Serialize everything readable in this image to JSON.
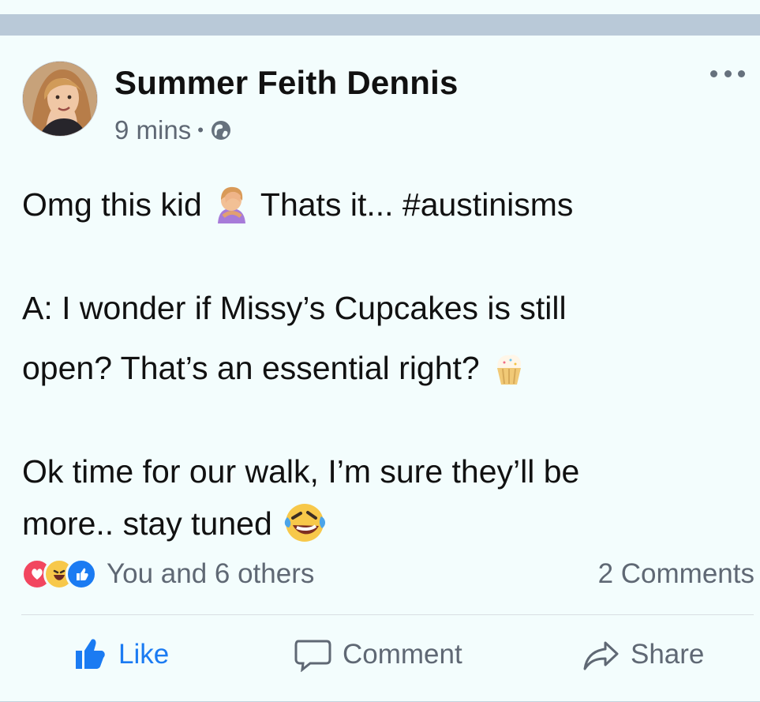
{
  "post": {
    "author": "Summer Feith Dennis",
    "time": "9 mins",
    "separator": "•",
    "privacy_icon": "globe-icon",
    "lines": [
      {
        "text_a": "Omg this kid",
        "text_b": " Thats it... #austinisms"
      },
      {
        "text": "A: I wonder if Missy’s Cupcakes is still"
      },
      {
        "text": "open? That’s an essential right? "
      },
      {
        "text": "Ok time for our walk, I’m sure they’ll be"
      },
      {
        "text": "more.. stay tuned"
      }
    ],
    "emojis": [
      "face-palm-emoji",
      "cupcake-emoji",
      "rolling-laughing-emoji"
    ]
  },
  "reactions": {
    "icons": [
      "heart-reaction-icon",
      "haha-reaction-icon",
      "like-reaction-icon"
    ],
    "summary": "You and 6 others",
    "comments": "2 Comments"
  },
  "actions": {
    "like": "Like",
    "comment": "Comment",
    "share": "Share"
  },
  "colors": {
    "accent": "#1b7bf2",
    "background": "#f3fdfd",
    "top_bar": "#b9c9d8",
    "muted_text": "#5f6874",
    "heart": "#f2465f",
    "haha": "#f7c84a"
  }
}
